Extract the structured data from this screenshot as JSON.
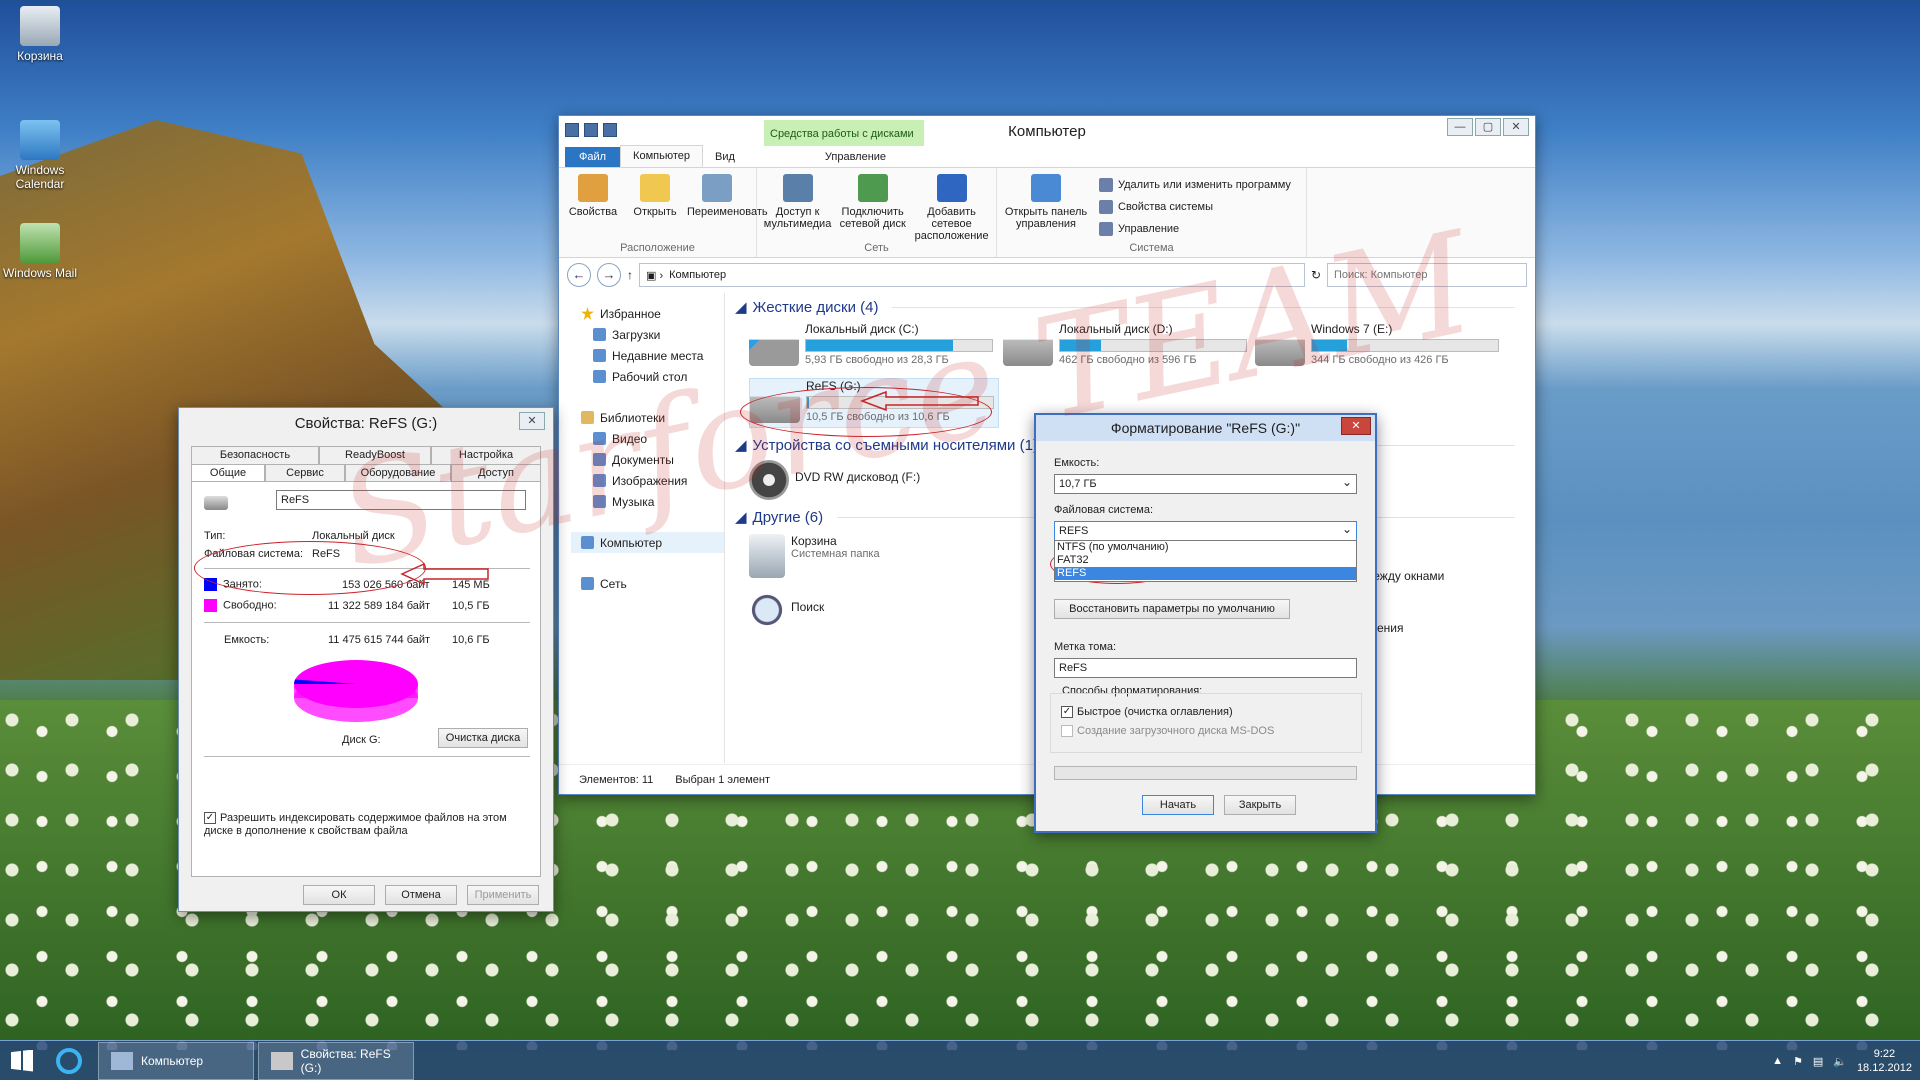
{
  "desktop": {
    "icons": [
      {
        "label": "Корзина"
      },
      {
        "label": "Windows Calendar"
      },
      {
        "label": "Windows Mail"
      }
    ]
  },
  "watermark": "Starforce TEAM",
  "explorer": {
    "title": "Компьютер",
    "context_tab": "Средства работы с дисками",
    "tabs": [
      "Файл",
      "Компьютер",
      "Вид",
      "Управление"
    ],
    "groups": [
      {
        "label": "Расположение",
        "buttons": [
          "Свойства",
          "Открыть",
          "Переименовать"
        ]
      },
      {
        "label": "Сеть",
        "buttons": [
          "Доступ к мультимедиа",
          "Подключить сетевой диск",
          "Добавить сетевое расположение"
        ]
      },
      {
        "label": "Система",
        "buttons": [
          "Открыть панель управления"
        ],
        "small": [
          "Удалить или изменить программу",
          "Свойства системы",
          "Управление"
        ]
      }
    ],
    "address": "Компьютер",
    "search_placeholder": "Поиск: Компьютер",
    "nav": [
      "Избранное",
      "Загрузки",
      "Недавние места",
      "Рабочий стол",
      "Библиотеки",
      "Видео",
      "Документы",
      "Изображения",
      "Музыка",
      "Компьютер",
      "Сеть"
    ],
    "sections": {
      "hdd": "Жесткие диски (4)",
      "removable": "Устройства со съемными носителями (1)",
      "other": "Другие (6)"
    },
    "drives": [
      {
        "name": "Локальный диск (C:)",
        "free": "5,93 ГБ свободно из 28,3 ГБ",
        "used": 0.79
      },
      {
        "name": "Локальный диск (D:)",
        "free": "462 ГБ свободно из 596 ГБ",
        "used": 0.22
      },
      {
        "name": "Windows 7 (E:)",
        "free": "344 ГБ свободно из 426 ГБ",
        "used": 0.19
      },
      {
        "name": "ReFS (G:)",
        "free": "10,5 ГБ свободно из 10,6 ГБ",
        "used": 0.01
      }
    ],
    "dvd": "DVD RW дисковод (F:)",
    "other_items": [
      {
        "name": "Корзина",
        "sub": "Системная папка"
      },
      {
        "name": "Поиск"
      }
    ],
    "partial_labels": [
      "е между окнами",
      "лючения"
    ],
    "status": {
      "count": "Элементов: 11",
      "selected": "Выбран 1 элемент"
    }
  },
  "props": {
    "title": "Свойства: ReFS (G:)",
    "tabs_top": [
      "Безопасность",
      "ReadyBoost",
      "Настройка"
    ],
    "tabs_bottom": [
      "Общие",
      "Сервис",
      "Оборудование",
      "Доступ"
    ],
    "name": "ReFS",
    "type_label": "Тип:",
    "type_value": "Локальный диск",
    "fs_label": "Файловая система:",
    "fs_value": "ReFS",
    "used_label": "Занято:",
    "used_bytes": "153 026 560 байт",
    "used_h": "145 МБ",
    "free_label": "Свободно:",
    "free_bytes": "11 322 589 184 байт",
    "free_h": "10,5 ГБ",
    "cap_label": "Емкость:",
    "cap_bytes": "11 475 615 744 байт",
    "cap_h": "10,6 ГБ",
    "disk_label": "Диск G:",
    "cleanup": "Очистка диска",
    "index_text": "Разрешить индексировать содержимое файлов на этом диске в дополнение к свойствам файла",
    "ok": "ОК",
    "cancel": "Отмена",
    "apply": "Применить",
    "colors": {
      "used": "#0000ff",
      "free": "#ff00ff"
    }
  },
  "fmt": {
    "title": "Форматирование \"ReFS (G:)\"",
    "capacity_label": "Емкость:",
    "capacity": "10,7 ГБ",
    "fs_label": "Файловая система:",
    "fs": "REFS",
    "options": [
      "NTFS (по умолчанию)",
      "FAT32",
      "REFS"
    ],
    "restore": "Восстановить параметры по умолчанию",
    "vol_label": "Метка тома:",
    "vol": "ReFS",
    "methods": "Способы форматирования:",
    "quick": "Быстрое (очистка оглавления)",
    "msdos": "Создание загрузочного диска MS-DOS",
    "start": "Начать",
    "close": "Закрыть"
  },
  "taskbar": {
    "items": [
      "Компьютер",
      "Свойства: ReFS (G:)"
    ],
    "time": "9:22",
    "date": "18.12.2012"
  }
}
